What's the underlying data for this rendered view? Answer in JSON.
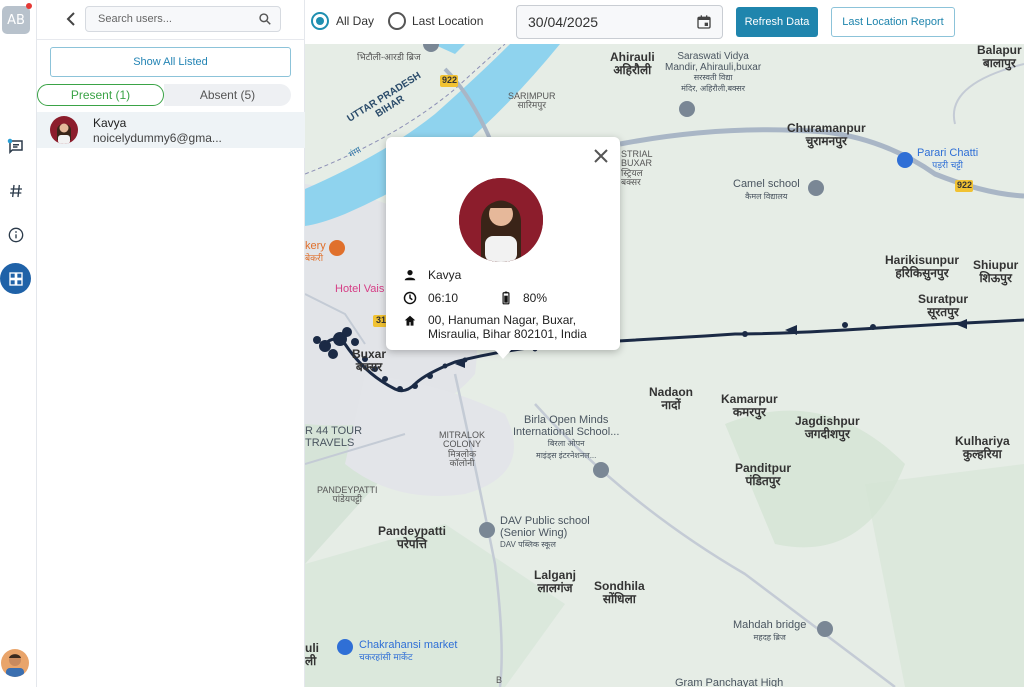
{
  "rail": {
    "avatar_initials": "AB"
  },
  "panel": {
    "search_placeholder": "Search users...",
    "show_all_label": "Show All Listed",
    "tab_present": "Present (1)",
    "tab_absent": "Absent (5)",
    "users": [
      {
        "name": "Kavya",
        "email": "noicelydummy6@gma..."
      }
    ]
  },
  "toolbar": {
    "radio_all_day": "All Day",
    "radio_last_location": "Last Location",
    "selected_mode": "All Day",
    "date_value": "30/04/2025",
    "refresh_label": "Refresh Data",
    "report_label": "Last Location Report"
  },
  "popup": {
    "name": "Kavya",
    "time": "06:10",
    "battery": "80%",
    "address_line1": "00, Hanuman Nagar, Buxar,",
    "address_line2": "Misraulia, Bihar 802101, India"
  },
  "map": {
    "labels": {
      "ahirauli": "Ahirauli",
      "ahirauli_hi": "अहिरौली",
      "saraswati": "Saraswati Vidya",
      "saraswati2": "Mandir, Ahirauli,buxar",
      "saraswati_hi": "सरस्वती विद्या",
      "saraswati_hi2": "मंदिर, अहिरौली,बक्सर",
      "churamanpur": "Churamanpur",
      "churamanpur_hi": "चुरामनपुर",
      "parari": "Parari Chatti",
      "parari_hi": "पड़री चट्टी",
      "balapur": "Balapur",
      "balapur_hi": "बालापुर",
      "camel": "Camel school",
      "camel_hi": "कैमल विद्यालय",
      "sarimpur": "SARIMPUR",
      "sarimpur_hi": "सारिमपुर",
      "up_line1": "UTTAR PRADESH",
      "up_line2": "BIHAR",
      "ganga_hi": "गंगा",
      "bhiti": "भिटौली-आरडी ब्रिज",
      "industrial": "STRIAL",
      "industrial2": "BUXAR",
      "industrial_hi": "स्ट्रियल",
      "industrial_hi2": "बक्सर",
      "harikisunpur": "Harikisunpur",
      "harikisunpur_hi": "हरिकिसुनपुर",
      "shiupur": "Shiupur",
      "shiupur_hi": "शिऊपुर",
      "suratpur": "Suratpur",
      "suratpur_hi": "सूरतपुर",
      "bakery": "kery",
      "bakery_hi": "बेकरी",
      "hotel": "Hotel Vais",
      "buxar": "Buxar",
      "buxar_hi": "बक्सर",
      "nadaon": "Nadaon",
      "nadaon_hi": "नादों",
      "kamarpur": "Kamarpur",
      "kamarpur_hi": "कमरपुर",
      "jagdishpur": "Jagdishpur",
      "jagdishpur_hi": "जगदीशपुर",
      "kulhariya": "Kulhariya",
      "kulhariya_hi": "कुल्हरिया",
      "birla1": "Birla Open Minds",
      "birla2": "International School...",
      "birla_hi1": "बिरला ओपन",
      "birla_hi2": "माइंड्स इंटरनेशनल...",
      "tour1": "R 44 TOUR",
      "tour2": "TRAVELS",
      "mitralok": "MITRALOK",
      "mitralok2": "COLONY",
      "mitralok_hi": "मित्रलोक",
      "mitralok_hi2": "कॉलोनी",
      "panditpur": "Panditpur",
      "panditpur_hi": "पंडितपुर",
      "pandeypatti_small": "PANDEYPATTI",
      "pandeypatti_small_hi": "पांडेयपट्टी",
      "pandeypatti": "Pandeypatti",
      "pandeypatti_hi": "परेपत्ति",
      "dav1": "DAV Public school",
      "dav2": "(Senior Wing)",
      "dav_hi": "DAV पब्लिक स्कूल",
      "lalganj": "Lalganj",
      "lalganj_hi": "लालगंज",
      "sondhila": "Sondhila",
      "sondhila_hi": "सोंधिला",
      "mahdah": "Mahdah bridge",
      "mahdah_hi": "महदह ब्रिज",
      "chakrahansi": "Chakrahansi market",
      "chakrahansi_hi": "चकरहांसी मार्केट",
      "gram": "Gram Panchayat High",
      "uli": "uli",
      "uli_hi": "ली",
      "road922a": "922",
      "road922b": "922",
      "road31": "31",
      "road_b": "B"
    }
  },
  "colors": {
    "accent": "#1f85ad",
    "present_green": "#3aa346",
    "route": "#1b2a45",
    "river": "#8fd3ee"
  }
}
